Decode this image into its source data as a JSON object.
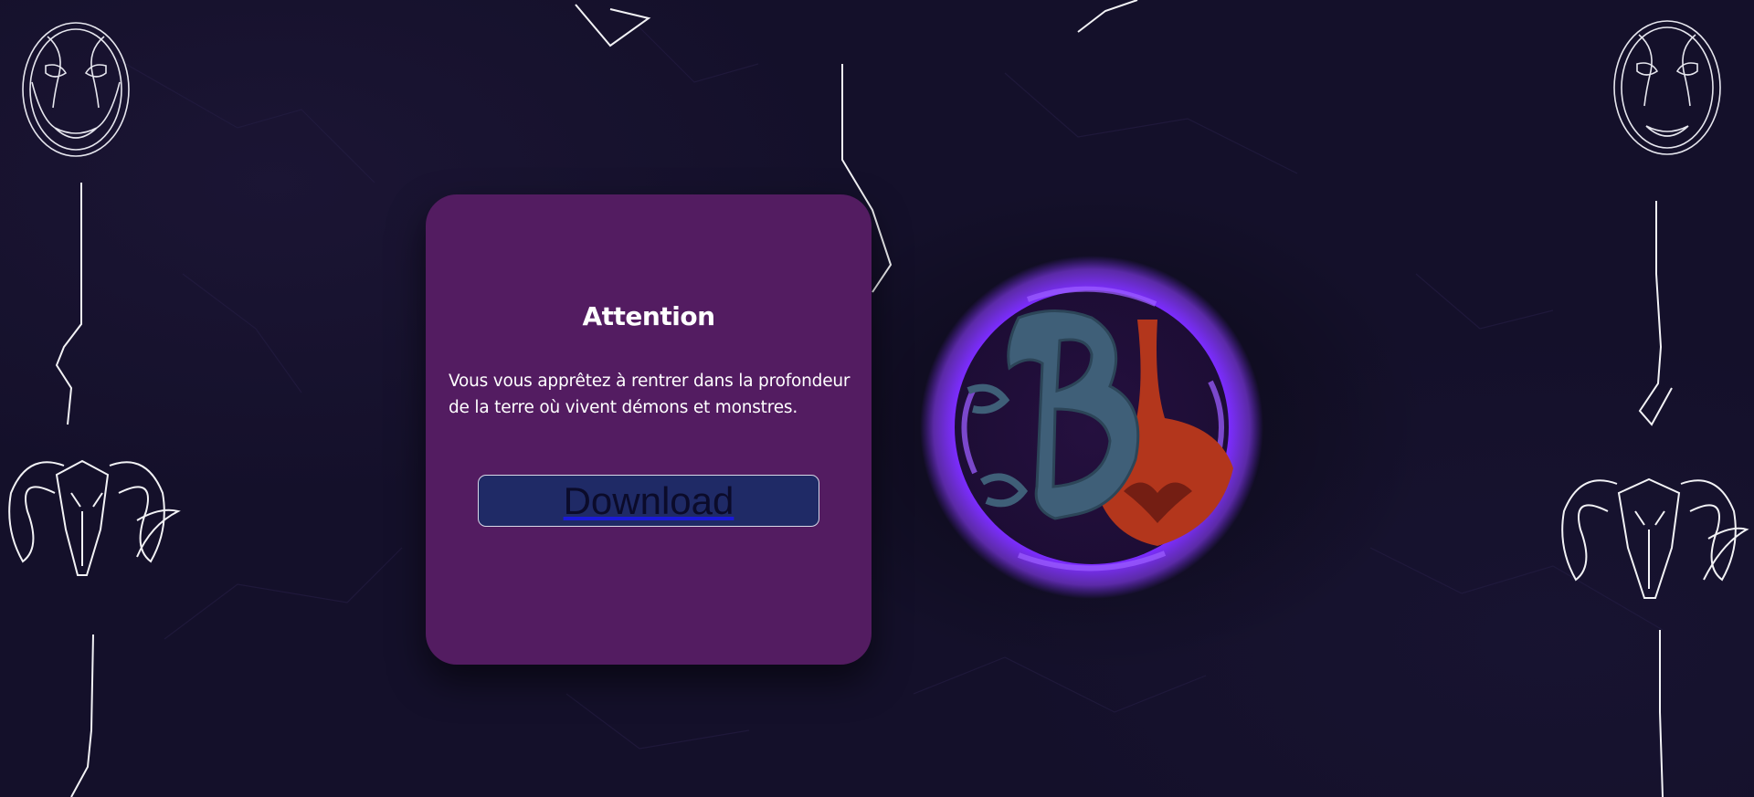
{
  "modal": {
    "title": "Attention",
    "message": "Vous vous apprêtez à rentrer dans la profondeur de la terre où vivent démons et monstres.",
    "download_label": "Download"
  },
  "icons": {
    "masks": "mask-icon",
    "skulls": "ram-skull-icon",
    "logo": "emblem-logo"
  },
  "colors": {
    "background": "#14102a",
    "modal": "#531c61",
    "button": "#1f2a66",
    "logo_glow": "#7b2cff",
    "logo_letter": "#3f5f78",
    "logo_red": "#b3361c"
  }
}
